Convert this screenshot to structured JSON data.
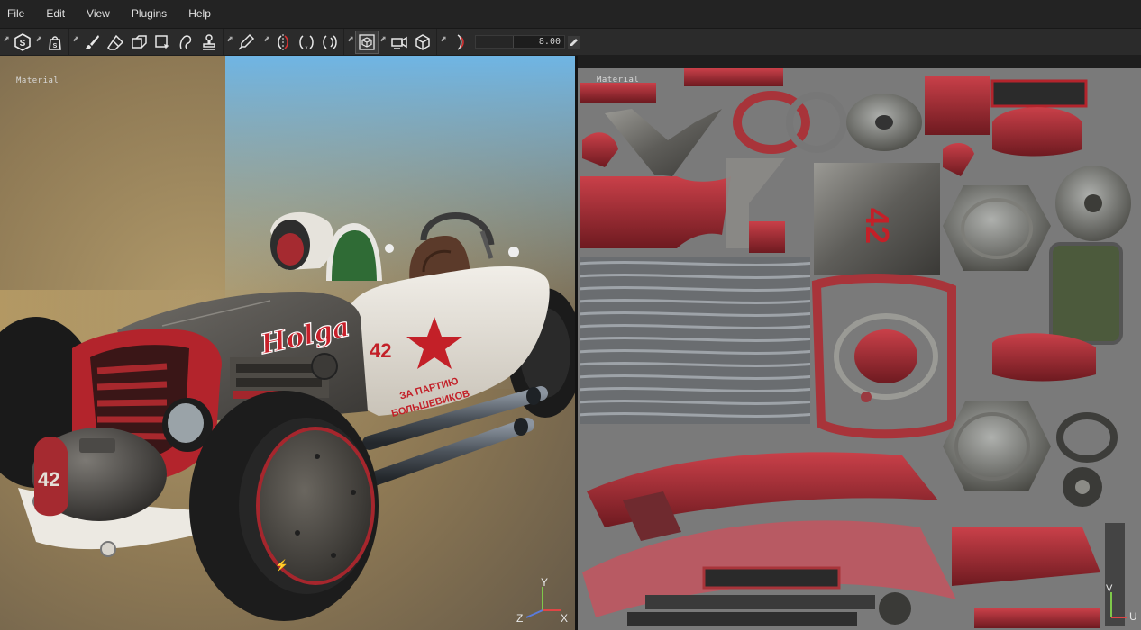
{
  "menu": {
    "items": [
      "File",
      "Edit",
      "View",
      "Plugins",
      "Help"
    ]
  },
  "toolbar": {
    "slider_value": "8.00",
    "tools": [
      "substance-s-icon",
      "substance-bag-icon",
      "paint-brush-icon",
      "eraser-icon",
      "projection-icon",
      "polygon-fill-icon",
      "smudge-icon",
      "clone-stamp-icon",
      "color-picker-icon",
      "symmetry-icon",
      "symmetry-x-icon",
      "symmetry-radial-icon",
      "camera-view-icon",
      "camera-icon",
      "cube-icon",
      "lighting-icon"
    ]
  },
  "viewport3d": {
    "label": "Material",
    "axis": {
      "y": "Y",
      "z": "Z",
      "x": "X"
    }
  },
  "viewport2d": {
    "label": "Material",
    "axis": {
      "v": "V",
      "u": "U"
    }
  },
  "colors": {
    "menubar": "#232323",
    "toolbar": "#2b2b2b",
    "car_red": "#b3242c",
    "car_white": "#e6e3dc",
    "uv_background": "#7a7a7a",
    "axis_y": "#7ec84a",
    "axis_x": "#e04545",
    "axis_z": "#5a7bdc"
  }
}
